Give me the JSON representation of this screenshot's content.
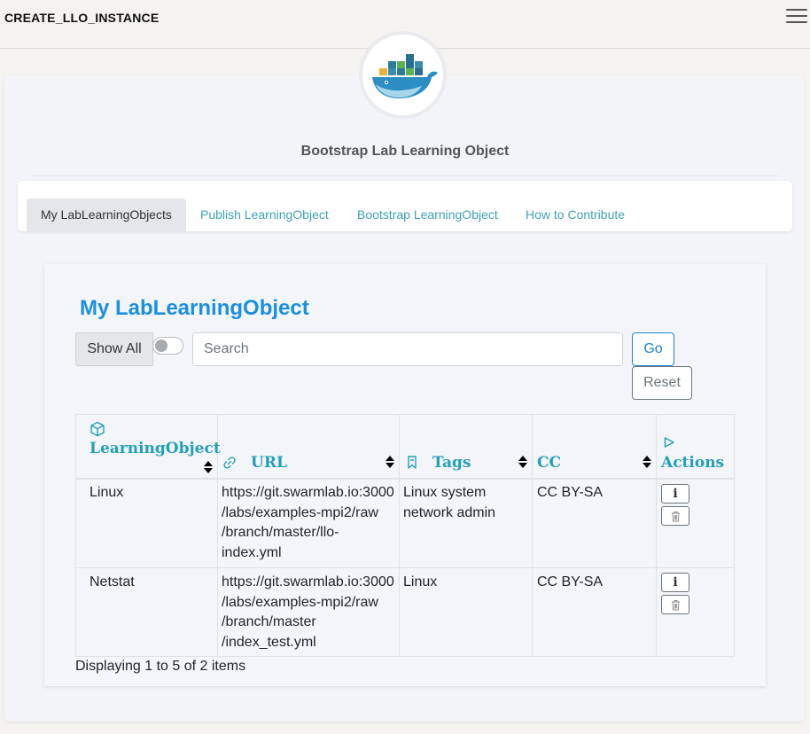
{
  "app": {
    "title": "CREATE_LLO_INSTANCE"
  },
  "header": {
    "subtitle": "Bootstrap Lab Learning Object"
  },
  "tabs": [
    {
      "label": "My LabLearningObjects",
      "active": true
    },
    {
      "label": "Publish LearningObject",
      "active": false
    },
    {
      "label": "Bootstrap LearningObject",
      "active": false
    },
    {
      "label": "How to Contribute",
      "active": false
    }
  ],
  "section": {
    "title": "My LabLearningObject"
  },
  "filter": {
    "show_all_label": "Show All",
    "toggle_on": false,
    "search_placeholder": "Search",
    "search_value": "",
    "go_label": "Go",
    "reset_label": "Reset"
  },
  "table": {
    "columns": [
      {
        "label": "LearningObject",
        "icon": "cube-icon"
      },
      {
        "label": "URL",
        "icon": "link-icon"
      },
      {
        "label": "Tags",
        "icon": "bookmark-icon"
      },
      {
        "label": "CC",
        "icon": ""
      },
      {
        "label": "Actions",
        "icon": "play-outline-icon"
      }
    ],
    "rows": [
      {
        "name": "Linux",
        "url_lines": [
          "https://git.swarmlab.io:3000",
          "/labs/examples-mpi2/raw",
          "/branch/master/llo-",
          "index.yml"
        ],
        "tags_lines": [
          "Linux system",
          "network admin"
        ],
        "cc": "CC BY-SA"
      },
      {
        "name": "Netstat",
        "url_lines": [
          "https://git.swarmlab.io:3000",
          "/labs/examples-mpi2/raw",
          "/branch/master",
          "/index_test.yml"
        ],
        "tags_lines": [
          "Linux"
        ],
        "cc": "CC BY-SA"
      }
    ],
    "info_glyph": "i"
  },
  "footer": {
    "status": "Displaying 1 to 5 of 2 items"
  },
  "colors": {
    "accent": "#1b8fe0",
    "teal": "#21a0b8",
    "tab_link": "#3fa2b5"
  }
}
